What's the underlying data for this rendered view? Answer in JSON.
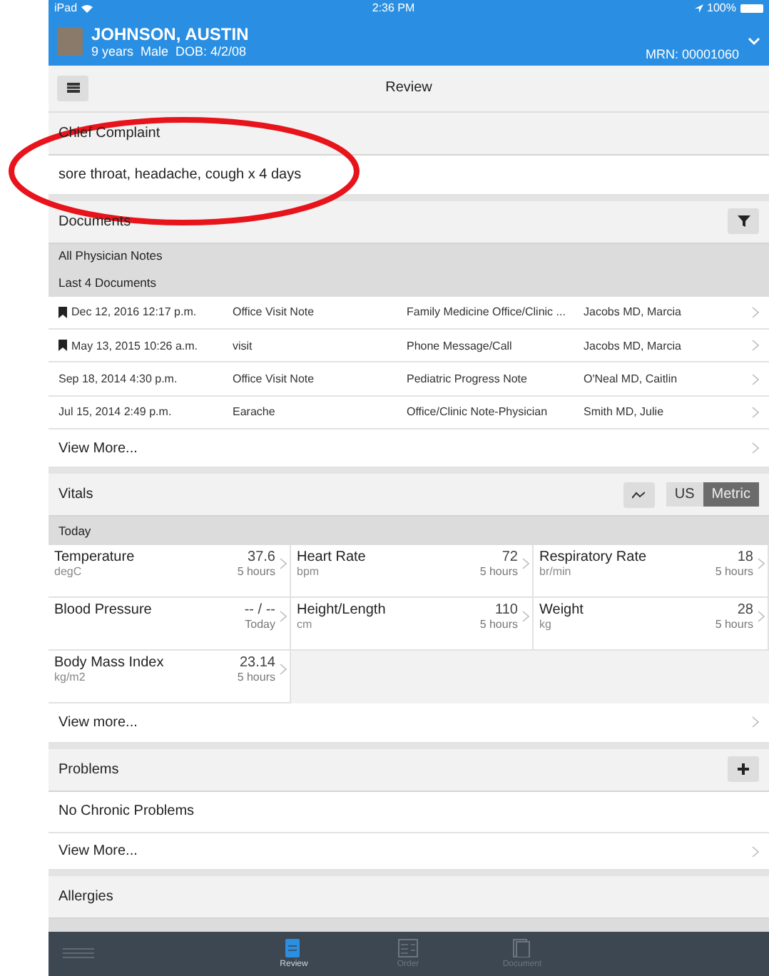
{
  "status_bar": {
    "device": "iPad",
    "time": "2:36 PM",
    "battery": "100%"
  },
  "patient": {
    "name": "JOHNSON, AUSTIN",
    "age": "9 years",
    "sex": "Male",
    "dob": "DOB: 4/2/08",
    "mrn": "MRN: 00001060"
  },
  "toolbar": {
    "title": "Review"
  },
  "chief_complaint": {
    "title": "Chief Complaint",
    "text": "sore throat, headache, cough x 4 days",
    "annotation": {
      "kind": "ellipse",
      "color": "#e8141b"
    }
  },
  "documents": {
    "title": "Documents",
    "filter": "All Physician Notes",
    "subtitle": "Last 4 Documents",
    "rows": [
      {
        "bookmarked": true,
        "date": "Dec 12, 2016 12:17 p.m.",
        "title": "Office Visit Note",
        "type": "Family Medicine Office/Clinic ...",
        "author": "Jacobs MD, Marcia"
      },
      {
        "bookmarked": true,
        "date": "May 13, 2015 10:26 a.m.",
        "title": "visit",
        "type": "Phone Message/Call",
        "author": "Jacobs MD, Marcia"
      },
      {
        "bookmarked": false,
        "date": "Sep 18, 2014 4:30 p.m.",
        "title": "Office Visit Note",
        "type": "Pediatric Progress Note",
        "author": "O'Neal MD, Caitlin"
      },
      {
        "bookmarked": false,
        "date": "Jul 15, 2014 2:49 p.m.",
        "title": "Earache",
        "type": "Office/Clinic Note-Physician",
        "author": "Smith MD, Julie"
      }
    ],
    "view_more": "View More..."
  },
  "vitals": {
    "title": "Vitals",
    "units": [
      {
        "label": "US",
        "selected": false
      },
      {
        "label": "Metric",
        "selected": true
      }
    ],
    "group": "Today",
    "items": [
      {
        "name": "Temperature",
        "value": "37.6",
        "unit": "degC",
        "time": "5 hours"
      },
      {
        "name": "Heart Rate",
        "value": "72",
        "unit": "bpm",
        "time": "5 hours"
      },
      {
        "name": "Respiratory Rate",
        "value": "18",
        "unit": "br/min",
        "time": "5 hours"
      },
      {
        "name": "Blood Pressure",
        "value": "-- / --",
        "time": "Today"
      },
      {
        "name": "Height/Length",
        "value": "110",
        "unit": "cm",
        "time": "5 hours"
      },
      {
        "name": "Weight",
        "value": "28",
        "unit": "kg",
        "time": "5 hours"
      },
      {
        "name": "Body Mass Index",
        "value": "23.14",
        "unit": "kg/m2",
        "time": "5 hours"
      }
    ],
    "view_more": "View more..."
  },
  "problems": {
    "title": "Problems",
    "items": [
      "No Chronic Problems"
    ],
    "view_more": "View More..."
  },
  "allergies": {
    "title": "Allergies"
  },
  "tab_bar": [
    {
      "label": "Review",
      "selected": true
    },
    {
      "label": "Order",
      "selected": false
    },
    {
      "label": "Document",
      "selected": false
    }
  ]
}
